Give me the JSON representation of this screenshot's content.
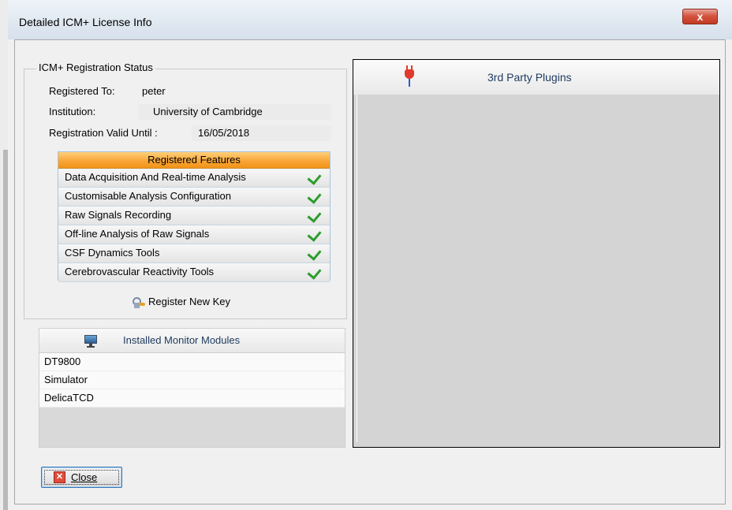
{
  "window": {
    "title": "Detailed ICM+ License Info",
    "close_glyph": "x"
  },
  "registration": {
    "group_title": "ICM+ Registration Status",
    "registered_to_label": "Registered To:",
    "registered_to_value": "peter",
    "institution_label": "Institution:",
    "institution_value": "University of Cambridge",
    "valid_until_label": "Registration Valid Until :",
    "valid_until_value": "16/05/2018",
    "features_header": "Registered Features",
    "features": [
      {
        "label": "Data Acquisition And Real-time Analysis",
        "enabled": true
      },
      {
        "label": "Customisable Analysis Configuration",
        "enabled": true
      },
      {
        "label": "Raw Signals Recording",
        "enabled": true
      },
      {
        "label": "Off-line Analysis of Raw Signals",
        "enabled": true
      },
      {
        "label": "CSF Dynamics Tools",
        "enabled": true
      },
      {
        "label": "Cerebrovascular Reactivity Tools",
        "enabled": true
      }
    ],
    "register_button": "Register New Key",
    "register_icon": "key-icon"
  },
  "monitors": {
    "header": "Installed Monitor Modules",
    "icon": "monitor-icon",
    "items": [
      "DT9800",
      "Simulator",
      "DelicaTCD"
    ]
  },
  "plugins": {
    "header": "3rd Party Plugins",
    "icon": "plug-icon"
  },
  "footer": {
    "close_label": "Close",
    "close_icon": "close-x-icon"
  },
  "colors": {
    "features_header": "#f7a333",
    "check": "#2c9c2c",
    "title_close": "#c9432e"
  }
}
